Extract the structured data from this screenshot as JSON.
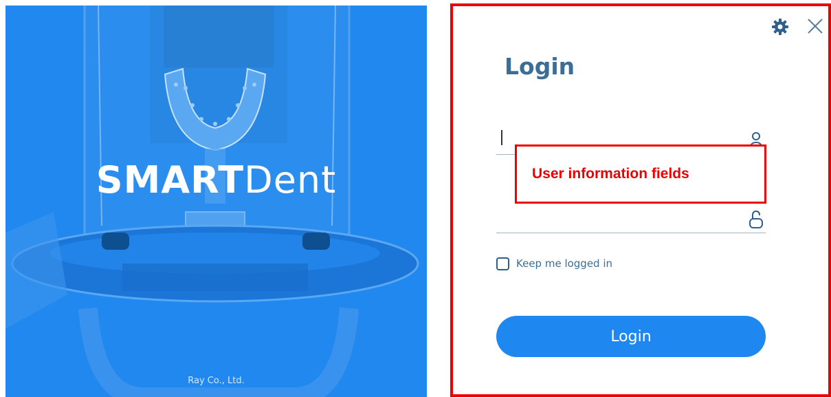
{
  "splash": {
    "brand_part1": "SMART",
    "brand_part2": "Dent",
    "company": "Ray Co., Ltd."
  },
  "login": {
    "title": "Login",
    "username": {
      "value": "",
      "placeholder": "",
      "icon": "user-icon"
    },
    "password": {
      "value": "",
      "placeholder": "",
      "icon": "lock-icon"
    },
    "keep_logged_in_label": "Keep me logged in",
    "keep_logged_in_checked": false,
    "submit_label": "Login",
    "settings_icon": "gear-icon",
    "close_icon": "close-icon"
  },
  "annotation": {
    "callout_text": "User information fields"
  },
  "colors": {
    "brand_blue": "#1e87f0",
    "title_blue": "#3a6e97",
    "annotation_red": "#ee0000"
  }
}
